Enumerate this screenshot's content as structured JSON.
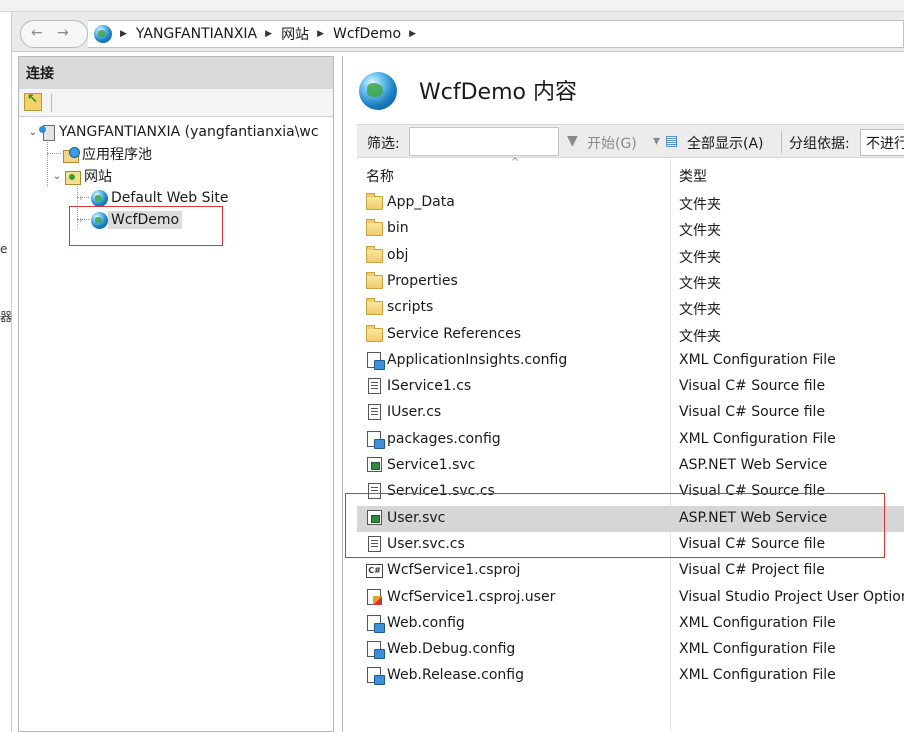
{
  "address_bar": {
    "crumbs": [
      "YANGFANTIANXIA",
      "网站",
      "WcfDemo"
    ]
  },
  "edge_fragments": [
    "e",
    "器"
  ],
  "connections": {
    "header": "连接",
    "tree": {
      "server": "YANGFANTIANXIA (yangfantianxia\\wc",
      "app_pools": "应用程序池",
      "sites": "网站",
      "default_site": "Default Web Site",
      "wcfdemo": "WcfDemo"
    }
  },
  "content": {
    "title": "WcfDemo 内容",
    "filter": {
      "label": "筛选:",
      "value": "",
      "go_label": "开始(G)",
      "show_all_label": "全部显示(A)",
      "group_by_label": "分组依据:",
      "group_by_value": "不进行"
    },
    "columns": {
      "name": "名称",
      "type": "类型"
    },
    "selected_row": "User.svc",
    "files": [
      {
        "name": "App_Data",
        "type": "文件夹",
        "icon": "folder-icon"
      },
      {
        "name": "bin",
        "type": "文件夹",
        "icon": "folder-icon"
      },
      {
        "name": "obj",
        "type": "文件夹",
        "icon": "folder-icon"
      },
      {
        "name": "Properties",
        "type": "文件夹",
        "icon": "folder-icon"
      },
      {
        "name": "scripts",
        "type": "文件夹",
        "icon": "folder-icon"
      },
      {
        "name": "Service References",
        "type": "文件夹",
        "icon": "folder-icon"
      },
      {
        "name": "ApplicationInsights.config",
        "type": "XML Configuration File",
        "icon": "config-file-icon"
      },
      {
        "name": "IService1.cs",
        "type": "Visual C# Source file",
        "icon": "cs-file-icon"
      },
      {
        "name": "IUser.cs",
        "type": "Visual C# Source file",
        "icon": "cs-file-icon"
      },
      {
        "name": "packages.config",
        "type": "XML Configuration File",
        "icon": "config-file-icon"
      },
      {
        "name": "Service1.svc",
        "type": "ASP.NET Web Service",
        "icon": "svc-file-icon"
      },
      {
        "name": "Service1.svc.cs",
        "type": "Visual C# Source file",
        "icon": "cs-file-icon"
      },
      {
        "name": "User.svc",
        "type": "ASP.NET Web Service",
        "icon": "svc-file-icon"
      },
      {
        "name": "User.svc.cs",
        "type": "Visual C# Source file",
        "icon": "cs-file-icon"
      },
      {
        "name": "WcfService1.csproj",
        "type": "Visual C# Project file",
        "icon": "csproj-file-icon"
      },
      {
        "name": "WcfService1.csproj.user",
        "type": "Visual Studio Project User Option",
        "icon": "csproj-user-file-icon"
      },
      {
        "name": "Web.config",
        "type": "XML Configuration File",
        "icon": "config-file-icon"
      },
      {
        "name": "Web.Debug.config",
        "type": "XML Configuration File",
        "icon": "config-file-icon"
      },
      {
        "name": "Web.Release.config",
        "type": "XML Configuration File",
        "icon": "config-file-icon"
      }
    ]
  },
  "colors": {
    "annotation_red": "#d9353a",
    "selection_gray": "#d6d6d6"
  }
}
